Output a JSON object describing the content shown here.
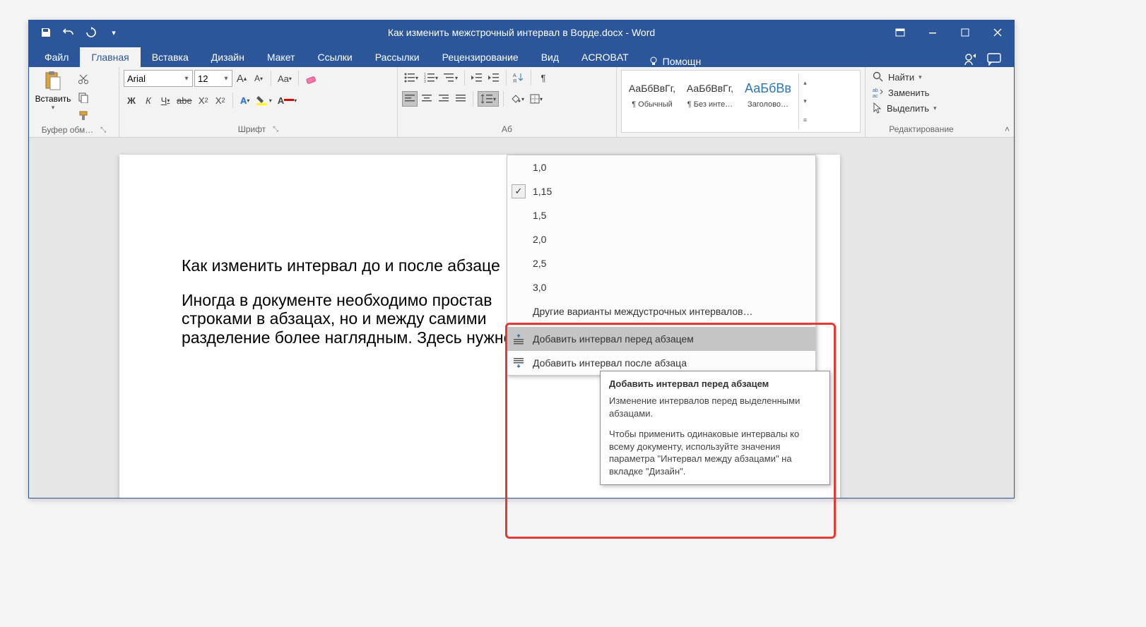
{
  "titlebar": {
    "title": "Как изменить межстрочный интервал в Ворде.docx - Word"
  },
  "tabs": {
    "file": "Файл",
    "home": "Главная",
    "insert": "Вставка",
    "design": "Дизайн",
    "layout": "Макет",
    "references": "Ссылки",
    "mailings": "Рассылки",
    "review": "Рецензирование",
    "view": "Вид",
    "acrobat": "ACROBAT",
    "tellme": "Помощн"
  },
  "ribbon": {
    "paste": "Вставить",
    "clipboard": "Буфер обм…",
    "font_name": "Arial",
    "font_size": "12",
    "font_group": "Шрифт",
    "para_group": "Аб",
    "styles": {
      "preview_normal": "АаБбВвГг,",
      "preview_nospace": "АаБбВвГг,",
      "preview_heading": "АаБбВв",
      "normal": "¶ Обычный",
      "nospace": "¶ Без инте…",
      "heading": "Заголово…"
    },
    "editing": {
      "find": "Найти",
      "replace": "Заменить",
      "select": "Выделить",
      "group": "Редактирование"
    }
  },
  "document": {
    "heading": "Как изменить интервал до и после абзаце",
    "body_l1": "Иногда в документе необходимо простав",
    "body_l2": "строками в абзацах, но и между самими",
    "body_l3": "разделение более наглядным. Здесь нужно деиство"
  },
  "menu": {
    "opt1": "1,0",
    "opt2": "1,15",
    "opt3": "1,5",
    "opt4": "2,0",
    "opt5": "2,5",
    "opt6": "3,0",
    "more": "Другие варианты междустрочных интервалов…",
    "add_before": "Добавить интервал перед абзацем",
    "add_after": "Добавить интервал после абзаца"
  },
  "tooltip": {
    "title": "Добавить интервал перед абзацем",
    "line1": "Изменение интервалов перед выделенными абзацами.",
    "line2": "Чтобы применить одинаковые интервалы ко всему документу, используйте значения параметра \"Интервал между абзацами\" на вкладке \"Дизайн\"."
  }
}
